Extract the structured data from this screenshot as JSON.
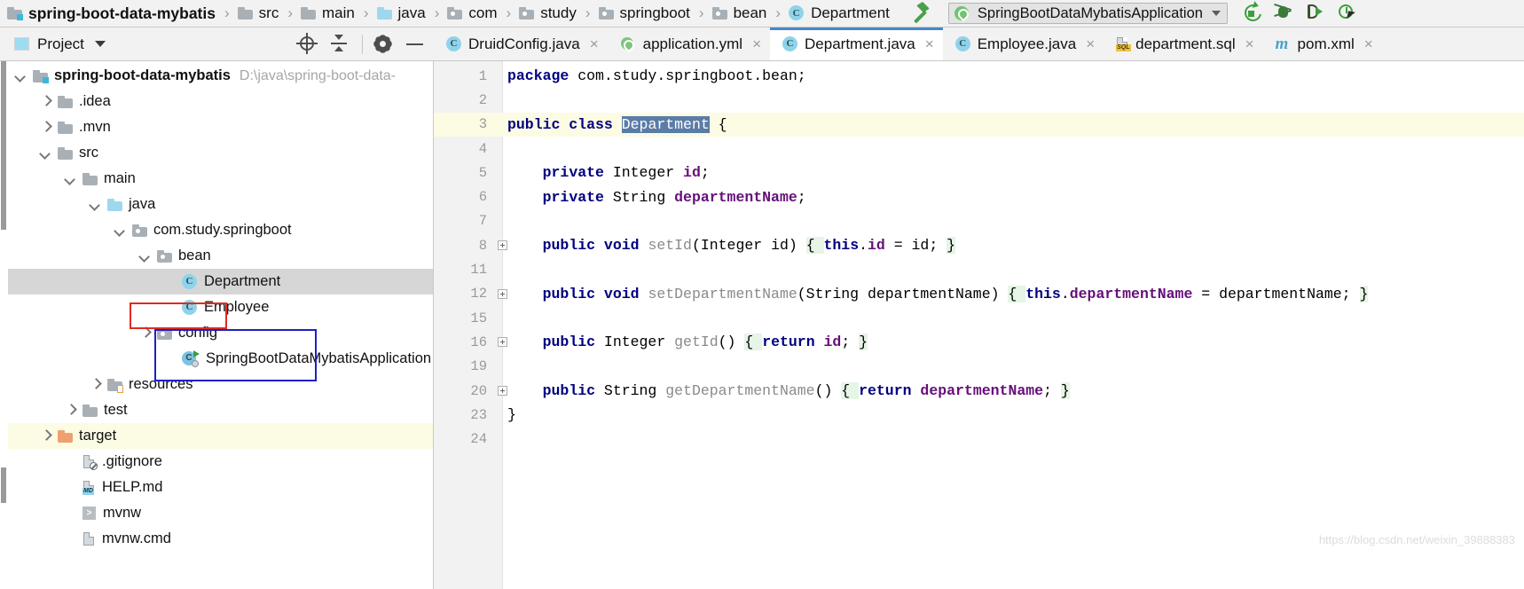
{
  "navbar": {
    "breadcrumbs": [
      {
        "label": "spring-boot-data-mybatis",
        "icon": "folder-module-icon",
        "kind": "root"
      },
      {
        "label": "src",
        "icon": "folder-icon",
        "kind": "folder"
      },
      {
        "label": "main",
        "icon": "folder-icon",
        "kind": "folder"
      },
      {
        "label": "java",
        "icon": "folder-source-icon",
        "kind": "source"
      },
      {
        "label": "com",
        "icon": "folder-package-icon",
        "kind": "package"
      },
      {
        "label": "study",
        "icon": "folder-package-icon",
        "kind": "package"
      },
      {
        "label": "springboot",
        "icon": "folder-package-icon",
        "kind": "package"
      },
      {
        "label": "bean",
        "icon": "folder-package-icon",
        "kind": "package"
      },
      {
        "label": "Department",
        "icon": "java-class-icon",
        "kind": "class"
      }
    ],
    "separator": "›",
    "build_icon": "hammer-icon",
    "run_config": {
      "label": "SpringBootDataMybatisApplication",
      "icon": "spring-boot-icon",
      "dropdown_icon": "chevron-down-icon"
    },
    "tool_buttons": [
      {
        "name": "rerun-button",
        "icon": "rerun-icon"
      },
      {
        "name": "debug-button",
        "icon": "bug-icon"
      },
      {
        "name": "run-with-coverage-button",
        "icon": "coverage-icon"
      },
      {
        "name": "profiler-button",
        "icon": "profiler-icon"
      }
    ]
  },
  "project_panel": {
    "title": "Project",
    "title_icon": "project-window-icon",
    "dropdown_icon": "caret-down-icon",
    "actions": [
      {
        "name": "select-opened-file-button",
        "icon": "target-icon"
      },
      {
        "name": "collapse-all-button",
        "icon": "collapse-all-icon"
      },
      {
        "name": "settings-button",
        "icon": "gear-icon"
      },
      {
        "name": "hide-button",
        "icon": "minus-icon"
      }
    ]
  },
  "tree": {
    "nodes": [
      {
        "label": "spring-boot-data-mybatis",
        "sub": "D:\\java\\spring-boot-data-",
        "indent": 0,
        "arrow": "down",
        "icon": "folder-module-icon",
        "bold": true,
        "state": "normal"
      },
      {
        "label": ".idea",
        "sub": "",
        "indent": 1,
        "arrow": "right",
        "icon": "folder-icon",
        "bold": false,
        "state": "normal"
      },
      {
        "label": ".mvn",
        "sub": "",
        "indent": 1,
        "arrow": "right",
        "icon": "folder-icon",
        "bold": false,
        "state": "normal"
      },
      {
        "label": "src",
        "sub": "",
        "indent": 1,
        "arrow": "down",
        "icon": "folder-icon",
        "bold": false,
        "state": "normal"
      },
      {
        "label": "main",
        "sub": "",
        "indent": 2,
        "arrow": "down",
        "icon": "folder-icon",
        "bold": false,
        "state": "normal"
      },
      {
        "label": "java",
        "sub": "",
        "indent": 3,
        "arrow": "down",
        "icon": "folder-source-icon",
        "bold": false,
        "state": "normal"
      },
      {
        "label": "com.study.springboot",
        "sub": "",
        "indent": 4,
        "arrow": "down",
        "icon": "folder-package-icon",
        "bold": false,
        "state": "normal"
      },
      {
        "label": "bean",
        "sub": "",
        "indent": 5,
        "arrow": "down",
        "icon": "folder-package-icon",
        "bold": false,
        "state": "normal"
      },
      {
        "label": "Department",
        "sub": "",
        "indent": 6,
        "arrow": "none",
        "icon": "java-class-icon",
        "bold": false,
        "state": "selected"
      },
      {
        "label": "Employee",
        "sub": "",
        "indent": 6,
        "arrow": "none",
        "icon": "java-class-icon",
        "bold": false,
        "state": "normal"
      },
      {
        "label": "config",
        "sub": "",
        "indent": 5,
        "arrow": "right",
        "icon": "folder-package-icon",
        "bold": false,
        "state": "normal"
      },
      {
        "label": "SpringBootDataMybatisApplication",
        "sub": "",
        "indent": 6,
        "arrow": "none",
        "icon": "spring-run-class-icon",
        "bold": false,
        "state": "normal"
      },
      {
        "label": "resources",
        "sub": "",
        "indent": 3,
        "arrow": "right",
        "icon": "folder-resources-icon",
        "bold": false,
        "state": "normal"
      },
      {
        "label": "test",
        "sub": "",
        "indent": 2,
        "arrow": "right",
        "icon": "folder-icon",
        "bold": false,
        "state": "normal"
      },
      {
        "label": "target",
        "sub": "",
        "indent": 1,
        "arrow": "right",
        "icon": "folder-excluded-icon",
        "bold": false,
        "state": "highlight"
      },
      {
        "label": ".gitignore",
        "sub": "",
        "indent": 2,
        "arrow": "none",
        "icon": "gitignore-file-icon",
        "bold": false,
        "state": "normal"
      },
      {
        "label": "HELP.md",
        "sub": "",
        "indent": 2,
        "arrow": "none",
        "icon": "markdown-file-icon",
        "bold": false,
        "state": "normal"
      },
      {
        "label": "mvnw",
        "sub": "",
        "indent": 2,
        "arrow": "none",
        "icon": "shell-script-icon",
        "bold": false,
        "state": "normal"
      },
      {
        "label": "mvnw.cmd",
        "sub": "",
        "indent": 2,
        "arrow": "none",
        "icon": "cmd-file-icon",
        "bold": false,
        "state": "normal"
      }
    ],
    "annotations": [
      {
        "name": "red-highlight-box",
        "color": "#e02b20",
        "target": "bean"
      },
      {
        "name": "blue-highlight-box",
        "color": "#1d20c9",
        "target": "Department,Employee"
      }
    ]
  },
  "editor_tabs": [
    {
      "label": "DruidConfig.java",
      "icon": "java-class-icon",
      "active": false,
      "close_icon": "×"
    },
    {
      "label": "application.yml",
      "icon": "spring-yaml-icon",
      "active": false,
      "close_icon": "×"
    },
    {
      "label": "Department.java",
      "icon": "java-class-icon",
      "active": true,
      "close_icon": "×"
    },
    {
      "label": "Employee.java",
      "icon": "java-class-icon",
      "active": false,
      "close_icon": "×"
    },
    {
      "label": "department.sql",
      "icon": "sql-file-icon",
      "active": false,
      "close_icon": "×"
    },
    {
      "label": "pom.xml",
      "icon": "maven-file-icon",
      "active": false,
      "close_icon": "×"
    }
  ],
  "editor": {
    "file": "Department.java",
    "selection": "Department",
    "caret_line": 3,
    "lines": [
      {
        "num": "1",
        "fold": false,
        "caret": false,
        "tokens": [
          {
            "t": "package",
            "c": "kw"
          },
          {
            "t": " com.study.springboot.bean;",
            "c": "plain"
          }
        ]
      },
      {
        "num": "2",
        "fold": false,
        "caret": false,
        "tokens": []
      },
      {
        "num": "3",
        "fold": false,
        "caret": true,
        "tokens": [
          {
            "t": "public class ",
            "c": "kw"
          },
          {
            "t": "Department",
            "c": "sel"
          },
          {
            "t": " {",
            "c": "plain"
          }
        ]
      },
      {
        "num": "4",
        "fold": false,
        "caret": false,
        "tokens": []
      },
      {
        "num": "5",
        "fold": false,
        "caret": false,
        "tokens": [
          {
            "t": "    ",
            "c": "plain"
          },
          {
            "t": "private",
            "c": "kw"
          },
          {
            "t": " Integer ",
            "c": "plain"
          },
          {
            "t": "id",
            "c": "fld"
          },
          {
            "t": ";",
            "c": "plain"
          }
        ]
      },
      {
        "num": "6",
        "fold": false,
        "caret": false,
        "tokens": [
          {
            "t": "    ",
            "c": "plain"
          },
          {
            "t": "private",
            "c": "kw"
          },
          {
            "t": " String ",
            "c": "plain"
          },
          {
            "t": "departmentName",
            "c": "fld"
          },
          {
            "t": ";",
            "c": "plain"
          }
        ]
      },
      {
        "num": "7",
        "fold": false,
        "caret": false,
        "tokens": []
      },
      {
        "num": "8",
        "fold": true,
        "caret": false,
        "tokens": [
          {
            "t": "    ",
            "c": "plain"
          },
          {
            "t": "public void ",
            "c": "kw"
          },
          {
            "t": "setId",
            "c": "mth"
          },
          {
            "t": "(Integer id) ",
            "c": "plain"
          },
          {
            "t": "{ ",
            "c": "brace"
          },
          {
            "t": "this",
            "c": "kw"
          },
          {
            "t": ".",
            "c": "plain"
          },
          {
            "t": "id",
            "c": "fld"
          },
          {
            "t": " = id; ",
            "c": "plain"
          },
          {
            "t": "}",
            "c": "brace"
          }
        ]
      },
      {
        "num": "11",
        "fold": false,
        "caret": false,
        "tokens": []
      },
      {
        "num": "12",
        "fold": true,
        "caret": false,
        "tokens": [
          {
            "t": "    ",
            "c": "plain"
          },
          {
            "t": "public void ",
            "c": "kw"
          },
          {
            "t": "setDepartmentName",
            "c": "mth"
          },
          {
            "t": "(String departmentName) ",
            "c": "plain"
          },
          {
            "t": "{ ",
            "c": "brace"
          },
          {
            "t": "this",
            "c": "kw"
          },
          {
            "t": ".",
            "c": "plain"
          },
          {
            "t": "departmentName",
            "c": "fld"
          },
          {
            "t": " = departmentName; ",
            "c": "plain"
          },
          {
            "t": "}",
            "c": "brace"
          }
        ]
      },
      {
        "num": "15",
        "fold": false,
        "caret": false,
        "tokens": []
      },
      {
        "num": "16",
        "fold": true,
        "caret": false,
        "tokens": [
          {
            "t": "    ",
            "c": "plain"
          },
          {
            "t": "public ",
            "c": "kw"
          },
          {
            "t": "Integer ",
            "c": "plain"
          },
          {
            "t": "getId",
            "c": "mth"
          },
          {
            "t": "() ",
            "c": "plain"
          },
          {
            "t": "{ ",
            "c": "brace"
          },
          {
            "t": "return",
            "c": "kw"
          },
          {
            "t": " ",
            "c": "plain"
          },
          {
            "t": "id",
            "c": "fld"
          },
          {
            "t": "; ",
            "c": "plain"
          },
          {
            "t": "}",
            "c": "brace"
          }
        ]
      },
      {
        "num": "19",
        "fold": false,
        "caret": false,
        "tokens": []
      },
      {
        "num": "20",
        "fold": true,
        "caret": false,
        "tokens": [
          {
            "t": "    ",
            "c": "plain"
          },
          {
            "t": "public ",
            "c": "kw"
          },
          {
            "t": "String ",
            "c": "plain"
          },
          {
            "t": "getDepartmentName",
            "c": "mth"
          },
          {
            "t": "() ",
            "c": "plain"
          },
          {
            "t": "{ ",
            "c": "brace"
          },
          {
            "t": "return",
            "c": "kw"
          },
          {
            "t": " ",
            "c": "plain"
          },
          {
            "t": "departmentName",
            "c": "fld"
          },
          {
            "t": "; ",
            "c": "plain"
          },
          {
            "t": "}",
            "c": "brace"
          }
        ]
      },
      {
        "num": "23",
        "fold": false,
        "caret": false,
        "tokens": [
          {
            "t": "}",
            "c": "plain"
          }
        ]
      },
      {
        "num": "24",
        "fold": false,
        "caret": false,
        "tokens": []
      }
    ]
  },
  "watermark": "https://blog.csdn.net/weixin_39888383"
}
